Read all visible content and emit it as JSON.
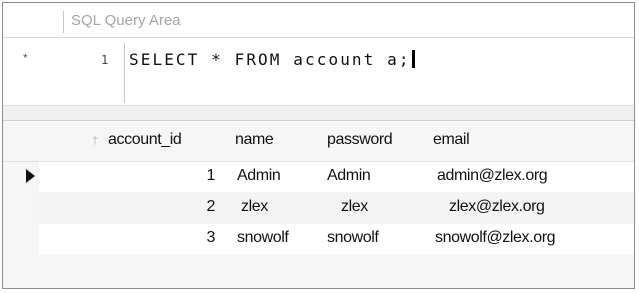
{
  "query_area": {
    "title": "SQL Query Area",
    "line_marker": "*",
    "line_number": "1",
    "sql": "SELECT * FROM account a;"
  },
  "result_grid": {
    "columns": [
      "account_id",
      "name",
      "password",
      "email"
    ],
    "primary_key_icon": "key-icon",
    "rows": [
      {
        "account_id": "1",
        "name": "Admin",
        "password": "Admin",
        "email": "admin@zlex.org"
      },
      {
        "account_id": "2",
        "name": "zlex",
        "password": "zlex",
        "email": "zlex@zlex.org"
      },
      {
        "account_id": "3",
        "name": "snowolf",
        "password": "snowolf",
        "email": "snowolf@zlex.org"
      }
    ]
  }
}
